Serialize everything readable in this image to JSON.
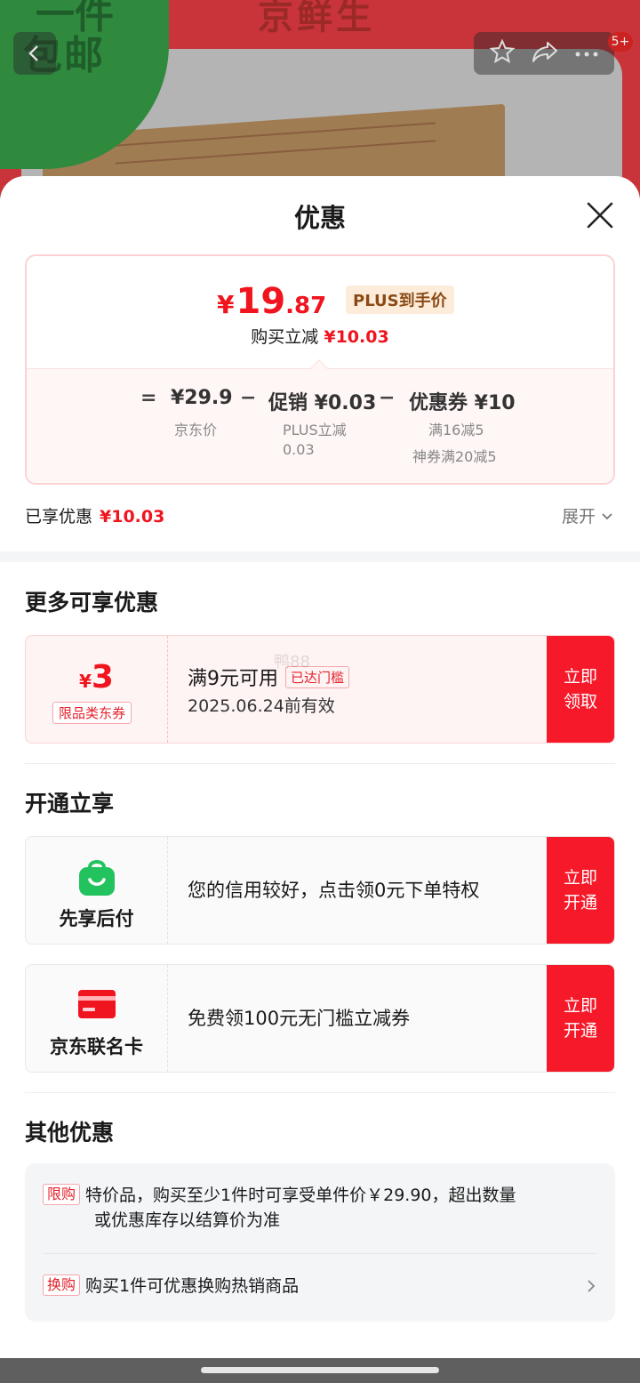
{
  "background": {
    "banner_text_top": "一件",
    "banner_text": "包邮",
    "brand_text": "京鲜生",
    "notification_badge": "5+",
    "box_text": ""
  },
  "sheet": {
    "title": "优惠",
    "price_card": {
      "yen": "¥",
      "final_price_int": "19",
      "final_price_dec": ".87",
      "plus_tag": "PLUS到手价",
      "saving_label": "购买立减",
      "saving_value": "¥10.03",
      "eq": "=",
      "minus": "−",
      "jd_price": "¥29.9",
      "jd_price_label": "京东价",
      "promo": "促销 ¥0.03",
      "promo_label_1": "PLUS立减",
      "promo_label_2": "0.03",
      "coupon": "优惠券 ¥10",
      "coupon_label_1": "满16减5",
      "coupon_label_2": "神券满20减5"
    },
    "enjoyed": {
      "label": "已享优惠",
      "value": "¥10.03",
      "expand": "展开"
    }
  },
  "more": {
    "title": "更多可享优惠",
    "coupon": {
      "yen": "¥",
      "amount": "3",
      "type": "限品类东券",
      "condition": "满9元可用",
      "reached": "已达门槛",
      "date": "2025.06.24前有效",
      "button_line1": "立即",
      "button_line2": "领取"
    }
  },
  "open": {
    "title": "开通立享",
    "items": [
      {
        "name": "先享后付",
        "desc": "您的信用较好，点击领0元下单特权",
        "button_line1": "立即",
        "button_line2": "开通",
        "icon": "shopping-bag-icon",
        "color": "#22c35e"
      },
      {
        "name": "京东联名卡",
        "desc": "免费领100元无门槛立减券",
        "button_line1": "立即",
        "button_line2": "开通",
        "icon": "credit-card-icon",
        "color": "#f0141e"
      }
    ]
  },
  "other": {
    "title": "其他优惠",
    "rows": [
      {
        "tag": "限购",
        "text_1": "特价品，购买至少1件时可享受单件价￥29.90，超出数量",
        "text_2": "或优惠库存以结算价为准"
      },
      {
        "tag": "换购",
        "text_1": "购买1件可优惠换购热销商品"
      }
    ]
  },
  "watermark": "鸭88",
  "colors": {
    "accent": "#f0141e",
    "button": "#f6192a",
    "plus_bg": "#fdecd9"
  }
}
